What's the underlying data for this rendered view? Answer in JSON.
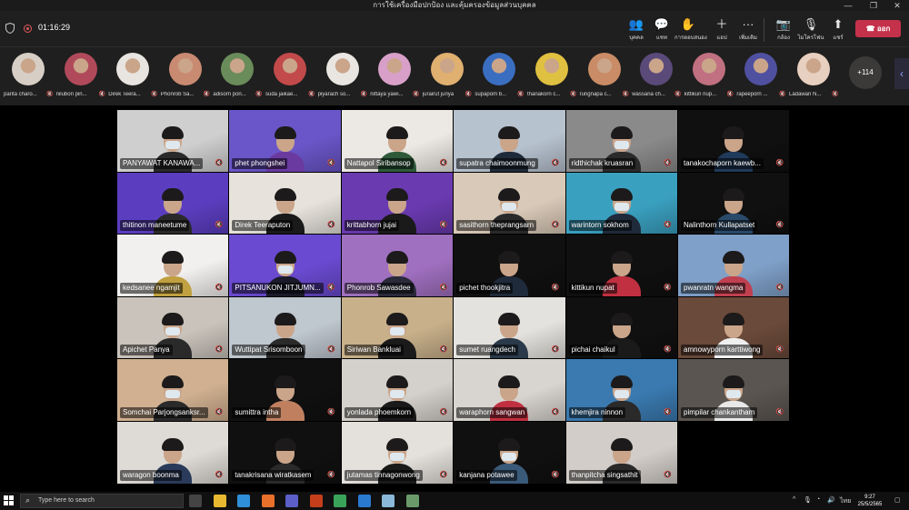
{
  "window": {
    "title": "การใช้เครื่องมือปกป้อง และคุ้มครองข้อมูลส่วนบุคคล",
    "minimize": "—",
    "restore": "❐",
    "close": "✕"
  },
  "toolbar": {
    "timer": "01:16:29",
    "buttons": [
      {
        "icon": "people-icon",
        "glyph": "👥",
        "label": "บุคคล"
      },
      {
        "icon": "chat-icon",
        "glyph": "💬",
        "label": "แชท"
      },
      {
        "icon": "reactions-icon",
        "glyph": "✋",
        "label": "การตอบสนอง"
      },
      {
        "icon": "apps-icon",
        "glyph": "＋",
        "label": "แอป"
      },
      {
        "icon": "more-icon",
        "glyph": "···",
        "label": "เพิ่มเติม"
      },
      {
        "icon": "camera-icon",
        "glyph": "📷",
        "label": "กล้อง"
      },
      {
        "icon": "mic-icon",
        "glyph": "🎙",
        "label": "ไมโครโฟน"
      },
      {
        "icon": "share-icon",
        "glyph": "⬆",
        "label": "แชร์"
      }
    ],
    "leave_label": "ออก",
    "leave_glyph": "☎"
  },
  "strip": {
    "participants": [
      {
        "name": "parita charo...",
        "color": "#d7cfc6"
      },
      {
        "name": "nilubon pin...",
        "color": "#b04a5a"
      },
      {
        "name": "Direk Teera...",
        "color": "#e8e4df"
      },
      {
        "name": "Phonrob Sa...",
        "color": "#c98a72"
      },
      {
        "name": "adisorn pon...",
        "color": "#6a8b5a"
      },
      {
        "name": "suda jaikae...",
        "color": "#c24a4a"
      },
      {
        "name": "piyarach so...",
        "color": "#e9e6e2"
      },
      {
        "name": "nittaya yawi...",
        "color": "#d8a0c8"
      },
      {
        "name": "jurairut junya",
        "color": "#e0b070"
      },
      {
        "name": "supapom b...",
        "color": "#3a6ec0"
      },
      {
        "name": "thanakorn c...",
        "color": "#e0c040"
      },
      {
        "name": "rungnapa c...",
        "color": "#c98c66"
      },
      {
        "name": "wassana ch...",
        "color": "#5a4a7a"
      },
      {
        "name": "kittikun nup...",
        "color": "#c07080"
      },
      {
        "name": "rapeeporn ...",
        "color": "#5050a0"
      },
      {
        "name": "Ladawan N...",
        "color": "#e8d0c0"
      }
    ],
    "more_count": "+114",
    "mute_glyph": "🔇"
  },
  "grid": {
    "tiles": [
      {
        "name": "PANYAWAT KANAWA...",
        "bg": "#cfcfcf",
        "shirt": "#2a2a2a",
        "mask": true
      },
      {
        "name": "phet phongshei",
        "bg": "#6a56c8",
        "shirt": "#6a3aa0",
        "mask": false
      },
      {
        "name": "Nattapol Siribansop",
        "bg": "#ece9e4",
        "shirt": "#2e5a3a",
        "mask": false
      },
      {
        "name": "supatra chaimoonmung",
        "bg": "#b7c2cf",
        "shirt": "#1f2a3a",
        "mask": false
      },
      {
        "name": "ridthichak kruasran",
        "bg": "#8a8a8a",
        "shirt": "#2a2a2a",
        "mask": true
      },
      {
        "name": "tanakochaporn kaewb...",
        "bg": "#101010",
        "shirt": "#1f3a5a",
        "mask": false
      },
      {
        "name": "thitinon maneetume",
        "bg": "#5b3ec0",
        "shirt": "#2a2a2a",
        "mask": false
      },
      {
        "name": "Direk Teeraputon",
        "bg": "#e7e3dc",
        "shirt": "#1a1a1a",
        "mask": false
      },
      {
        "name": "krittabhorn jujai",
        "bg": "#6a3ab0",
        "shirt": "#1a1a1a",
        "mask": false
      },
      {
        "name": "sasithorn theprangsarn",
        "bg": "#d9c9b8",
        "shirt": "#2a2a2a",
        "mask": true
      },
      {
        "name": "warintorn sokhom",
        "bg": "#3aa0c0",
        "shirt": "#1f2a3a",
        "mask": true
      },
      {
        "name": "Nalinthorn Kullapatset",
        "bg": "#101010",
        "shirt": "#2a4a6a",
        "mask": false
      },
      {
        "name": "kedsanee ngamjit",
        "bg": "#f2f0ee",
        "shirt": "#c0a040",
        "mask": false
      },
      {
        "name": "PITSANUKON JITJUMN...",
        "bg": "#6a4ad0",
        "shirt": "#1a1a2a",
        "mask": true
      },
      {
        "name": "Phonrob Sawasdee",
        "bg": "#a070c0",
        "shirt": "#2a2a3a",
        "mask": false
      },
      {
        "name": "pichet thookjitra",
        "bg": "#101010",
        "shirt": "#1f2a3a",
        "mask": false
      },
      {
        "name": "kittikun nupat",
        "bg": "#101010",
        "shirt": "#c03040",
        "mask": false
      },
      {
        "name": "pwanratn wangma",
        "bg": "#7fa0c8",
        "shirt": "#c04050",
        "mask": false
      },
      {
        "name": "Apichet Panya",
        "bg": "#c9c3bb",
        "shirt": "#2a2a2a",
        "mask": true
      },
      {
        "name": "Wuttipat Srisomboon",
        "bg": "#bfc7cf",
        "shirt": "#2a2a2a",
        "mask": false
      },
      {
        "name": "Siriwan Bankluai",
        "bg": "#c8b08a",
        "shirt": "#1a1a1a",
        "mask": true
      },
      {
        "name": "sumet ruangdech",
        "bg": "#e4e2de",
        "shirt": "#2a3a4a",
        "mask": false
      },
      {
        "name": "pichai chaikul",
        "bg": "#101010",
        "shirt": "#1a1a1a",
        "mask": false
      },
      {
        "name": "amnowyporn karttiwong",
        "bg": "#6a4a3a",
        "shirt": "#f0f0f0",
        "mask": false
      },
      {
        "name": "Somchai Parjongsanksr...",
        "bg": "#d0b090",
        "shirt": "#2a2a2a",
        "mask": true
      },
      {
        "name": "sumittra intha",
        "bg": "#101010",
        "shirt": "#c08060",
        "mask": false
      },
      {
        "name": "yonlada phoemkorn",
        "bg": "#d4d0cb",
        "shirt": "#1a1a1a",
        "mask": true
      },
      {
        "name": "waraphorn sangwan",
        "bg": "#d8d4cf",
        "shirt": "#c03040",
        "mask": false
      },
      {
        "name": "khemjira ninnon",
        "bg": "#3a7ab0",
        "shirt": "#2a2a2a",
        "mask": true
      },
      {
        "name": "pimpilar chankantham",
        "bg": "#5a5550",
        "shirt": "#e8e8e8",
        "mask": true
      },
      {
        "name": "waragon boonma",
        "bg": "#dedad5",
        "shirt": "#2a3a5a",
        "mask": false
      },
      {
        "name": "tanakrisana wiratkasem",
        "bg": "#101010",
        "shirt": "#2a2a2a",
        "mask": false
      },
      {
        "name": "jutamas tinnagonwong",
        "bg": "#e4e0db",
        "shirt": "#1a1a1a",
        "mask": true
      },
      {
        "name": "kanjana potawee",
        "bg": "#101010",
        "shirt": "#3a5a7a",
        "mask": true
      },
      {
        "name": "thanpitcha singsathit",
        "bg": "#d2cdc8",
        "shirt": "#2a2a2a",
        "mask": false
      }
    ]
  },
  "taskbar": {
    "search_placeholder": "Type here to search",
    "apps": [
      {
        "icon": "task-view-icon",
        "color": "#444"
      },
      {
        "icon": "file-explorer-icon",
        "color": "#e8b830"
      },
      {
        "icon": "edge-icon",
        "color": "#2f8fd8"
      },
      {
        "icon": "firefox-icon",
        "color": "#e8702a"
      },
      {
        "icon": "teams-icon",
        "color": "#5b5fc7"
      },
      {
        "icon": "powerpoint-icon",
        "color": "#c43e1c"
      },
      {
        "icon": "chrome-icon",
        "color": "#3aa35a"
      },
      {
        "icon": "photos-icon",
        "color": "#2a7ad0"
      },
      {
        "icon": "app-icon",
        "color": "#8ab8d8"
      },
      {
        "icon": "app2-icon",
        "color": "#6a9a6a"
      }
    ],
    "lang": "ไทย",
    "time": "9:27",
    "date": "25/5/2565"
  }
}
